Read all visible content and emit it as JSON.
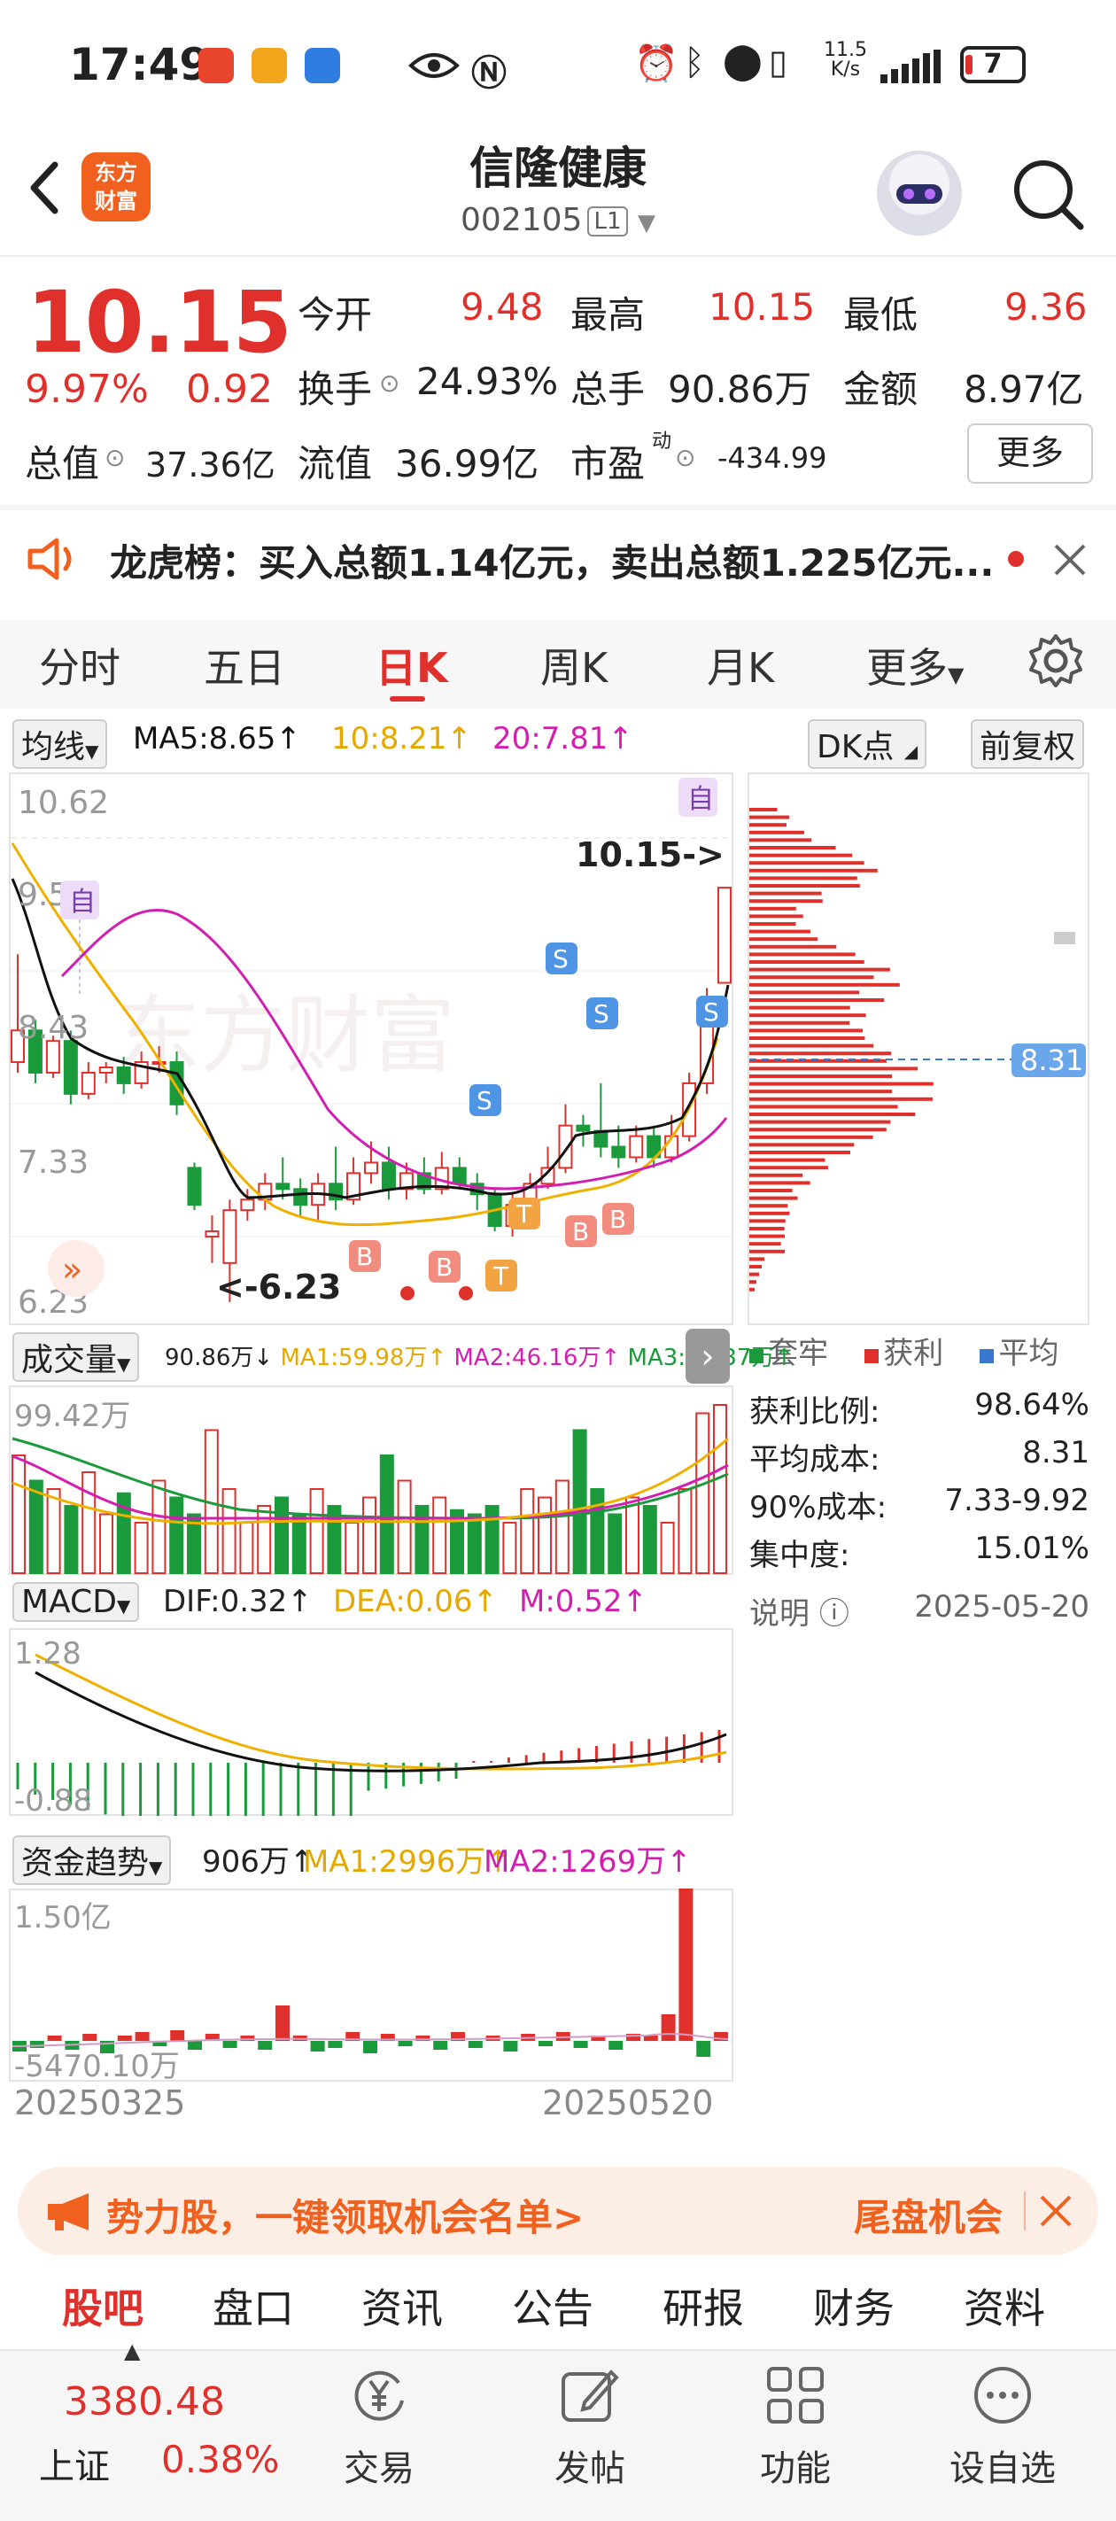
{
  "status_bar": {
    "time": "17:49",
    "net_speed_top": "11.5",
    "net_speed_bottom": "K/s",
    "battery": "7"
  },
  "header": {
    "logo_line1": "东方",
    "logo_line2": "财富",
    "stock_name": "信隆健康",
    "stock_code": "002105",
    "level_badge": "L1"
  },
  "quote": {
    "price": "10.15",
    "change_pct": "9.97%",
    "change": "0.92",
    "open_label": "今开",
    "open": "9.48",
    "high_label": "最高",
    "high": "10.15",
    "low_label": "最低",
    "low": "9.36",
    "turnover_label": "换手",
    "turnover": "24.93%",
    "volume_label": "总手",
    "volume": "90.86万",
    "amount_label": "金额",
    "amount": "8.97亿",
    "mktcap_label": "总值",
    "mktcap": "37.36亿",
    "float_label": "流值",
    "float_cap": "36.99亿",
    "pe_label": "市盈",
    "pe_sup": "动",
    "pe": "-434.99",
    "more_label": "更多"
  },
  "notice": {
    "text": "龙虎榜：买入总额1.14亿元，卖出总额1.225亿元..."
  },
  "tabs": [
    "分时",
    "五日",
    "日K",
    "周K",
    "月K",
    "更多"
  ],
  "kline": {
    "ma_selector": "均线",
    "ma5": "MA5:8.65↑",
    "ma10": "10:8.21↑",
    "ma20": "20:7.81↑",
    "dk_label": "DK点",
    "adjust_label": "前复权",
    "y_top": "10.62",
    "y_2": "9.52",
    "y_3": "8.43",
    "y_4": "7.33",
    "y_bottom": "6.23",
    "last_price_tag": "10.15->",
    "low_tag": "<-6.23",
    "self_tag": "自",
    "watermark": "东方财富"
  },
  "chip": {
    "avg_cost_tag": "8.31",
    "legend_trapped": "套牢",
    "legend_profit": "获利",
    "legend_avg": "平均",
    "rows": [
      {
        "label": "获利比例:",
        "value": "98.64%"
      },
      {
        "label": "平均成本:",
        "value": "8.31"
      },
      {
        "label": "90%成本:",
        "value": "7.33-9.92"
      },
      {
        "label": "集中度:",
        "value": "15.01%"
      }
    ],
    "explain": "说明",
    "date": "2025-05-20"
  },
  "volume": {
    "selector": "成交量",
    "vol": "90.86万↓",
    "ma1": "MA1:59.98万↑",
    "ma2": "MA2:46.16万↑",
    "ma3": "MA3:38.37万↑",
    "y_top": "99.42万"
  },
  "macd": {
    "selector": "MACD",
    "dif": "DIF:0.32↑",
    "dea": "DEA:0.06↑",
    "m": "M:0.52↑",
    "y_top": "1.28",
    "y_bottom": "-0.88"
  },
  "capital": {
    "selector": "资金趋势",
    "value": "906万↑",
    "ma1": "MA1:2996万↑",
    "ma2": "MA2:1269万↑",
    "y_top": "1.50亿",
    "y_bottom": "-5470.10万",
    "date_start": "20250325",
    "date_end": "20250520"
  },
  "banner": {
    "text": "势力股，一键领取机会名单>",
    "right_text": "尾盘机会"
  },
  "bottom_tabs": [
    "股吧",
    "盘口",
    "资讯",
    "公告",
    "研报",
    "财务",
    "资料"
  ],
  "bottom_nav": {
    "index_value": "3380.48",
    "index_name": "上证",
    "index_change": "0.38%",
    "items": [
      "交易",
      "发帖",
      "功能",
      "设自选"
    ]
  },
  "colors": {
    "up": "#e0302b",
    "down": "#1a9a3a",
    "ma5": "#111111",
    "ma10": "#f0b000",
    "ma20": "#d21fb0",
    "accent": "#f0601e"
  },
  "chart_data": {
    "type": "candlestick",
    "title": "",
    "y_range": [
      6.23,
      10.62
    ],
    "candles": [
      {
        "o": 8.5,
        "c": 8.8,
        "h": 9.52,
        "l": 8.4
      },
      {
        "o": 8.8,
        "c": 8.4,
        "h": 8.9,
        "l": 8.3
      },
      {
        "o": 8.4,
        "c": 8.7,
        "h": 8.75,
        "l": 8.35
      },
      {
        "o": 8.7,
        "c": 8.2,
        "h": 8.8,
        "l": 8.1
      },
      {
        "o": 8.2,
        "c": 8.4,
        "h": 8.5,
        "l": 8.15
      },
      {
        "o": 8.4,
        "c": 8.45,
        "h": 8.5,
        "l": 8.3
      },
      {
        "o": 8.45,
        "c": 8.3,
        "h": 8.55,
        "l": 8.2
      },
      {
        "o": 8.3,
        "c": 8.5,
        "h": 8.6,
        "l": 8.25
      },
      {
        "o": 8.5,
        "c": 8.5,
        "h": 8.65,
        "l": 8.4
      },
      {
        "o": 8.5,
        "c": 8.1,
        "h": 8.6,
        "l": 8.0
      },
      {
        "o": 7.5,
        "c": 7.15,
        "h": 7.55,
        "l": 7.1
      },
      {
        "o": 6.85,
        "c": 6.9,
        "h": 7.05,
        "l": 6.6
      },
      {
        "o": 6.6,
        "c": 7.1,
        "h": 7.2,
        "l": 6.23
      },
      {
        "o": 7.1,
        "c": 7.2,
        "h": 7.3,
        "l": 7.0
      },
      {
        "o": 7.2,
        "c": 7.35,
        "h": 7.45,
        "l": 7.1
      },
      {
        "o": 7.35,
        "c": 7.3,
        "h": 7.6,
        "l": 7.2
      },
      {
        "o": 7.3,
        "c": 7.15,
        "h": 7.4,
        "l": 7.05
      },
      {
        "o": 7.15,
        "c": 7.35,
        "h": 7.45,
        "l": 7.0
      },
      {
        "o": 7.35,
        "c": 7.2,
        "h": 7.7,
        "l": 7.1
      },
      {
        "o": 7.2,
        "c": 7.45,
        "h": 7.6,
        "l": 7.15
      },
      {
        "o": 7.45,
        "c": 7.55,
        "h": 7.75,
        "l": 7.35
      },
      {
        "o": 7.55,
        "c": 7.3,
        "h": 7.7,
        "l": 7.2
      },
      {
        "o": 7.3,
        "c": 7.45,
        "h": 7.55,
        "l": 7.2
      },
      {
        "o": 7.45,
        "c": 7.3,
        "h": 7.6,
        "l": 7.25
      },
      {
        "o": 7.3,
        "c": 7.5,
        "h": 7.65,
        "l": 7.25
      },
      {
        "o": 7.5,
        "c": 7.35,
        "h": 7.6,
        "l": 7.3
      },
      {
        "o": 7.35,
        "c": 7.25,
        "h": 7.45,
        "l": 7.1
      },
      {
        "o": 7.25,
        "c": 6.95,
        "h": 7.3,
        "l": 6.9
      },
      {
        "o": 6.95,
        "c": 7.15,
        "h": 7.25,
        "l": 6.85
      },
      {
        "o": 7.15,
        "c": 7.35,
        "h": 7.45,
        "l": 7.1
      },
      {
        "o": 7.35,
        "c": 7.5,
        "h": 7.7,
        "l": 7.3
      },
      {
        "o": 7.5,
        "c": 7.9,
        "h": 8.1,
        "l": 7.45
      },
      {
        "o": 7.9,
        "c": 7.85,
        "h": 8.0,
        "l": 7.7
      },
      {
        "o": 7.85,
        "c": 7.7,
        "h": 8.3,
        "l": 7.6
      },
      {
        "o": 7.7,
        "c": 7.6,
        "h": 7.9,
        "l": 7.5
      },
      {
        "o": 7.6,
        "c": 7.8,
        "h": 7.9,
        "l": 7.55
      },
      {
        "o": 7.8,
        "c": 7.6,
        "h": 7.9,
        "l": 7.5
      },
      {
        "o": 7.6,
        "c": 7.8,
        "h": 8.0,
        "l": 7.55
      },
      {
        "o": 7.8,
        "c": 8.3,
        "h": 8.4,
        "l": 7.75
      },
      {
        "o": 8.3,
        "c": 9.1,
        "h": 9.2,
        "l": 8.2
      },
      {
        "o": 9.25,
        "c": 10.15,
        "h": 10.15,
        "l": 9.36
      }
    ]
  }
}
